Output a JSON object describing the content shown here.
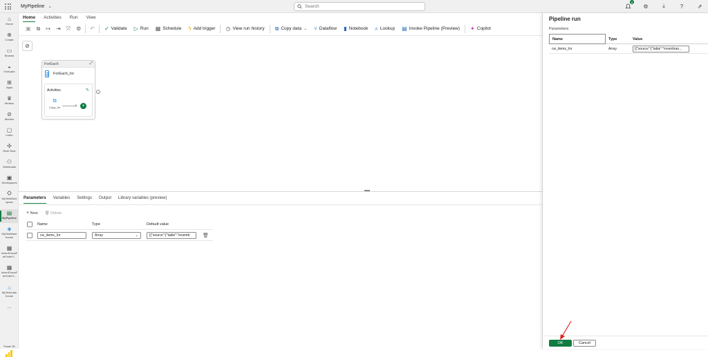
{
  "app": {
    "workspace_name": "MyPipeline",
    "search_placeholder": "Search",
    "notification_count": "8"
  },
  "colors": {
    "accent": "#107c41",
    "annotation_arrow": "#e02020",
    "powerbi_logo": "#f2c811"
  },
  "nav": {
    "items": [
      {
        "label": "Home",
        "icon": "home-icon"
      },
      {
        "label": "Create",
        "icon": "create-icon"
      },
      {
        "label": "Browse",
        "icon": "browse-icon"
      },
      {
        "label": "OneLake",
        "icon": "onelake-icon"
      },
      {
        "label": "Apps",
        "icon": "apps-icon"
      },
      {
        "label": "Metrics",
        "icon": "metrics-icon"
      },
      {
        "label": "Monitor",
        "icon": "monitor-icon"
      },
      {
        "label": "Learn",
        "icon": "learn-icon"
      },
      {
        "label": "Real-Time",
        "icon": "realtime-icon"
      },
      {
        "label": "Workloads",
        "icon": "workloads-icon"
      },
      {
        "label": "Workspaces",
        "icon": "workspaces-icon"
      },
      {
        "label": "MyTestWork space",
        "icon": "workspace-icon"
      },
      {
        "label": "MyPipeline",
        "icon": "pipeline-icon"
      },
      {
        "label": "MyTestWare house",
        "icon": "warehouse-icon"
      },
      {
        "label": "InventTransF arOrderV...",
        "icon": "table-icon"
      },
      {
        "label": "InventTransF arOrderV...",
        "icon": "table-icon"
      },
      {
        "label": "MyTestLake house",
        "icon": "lakehouse-icon"
      },
      {
        "label": "...",
        "icon": "more-icon"
      }
    ],
    "bottom_label": "Power BI"
  },
  "ribbon": {
    "tabs": [
      "Home",
      "Activities",
      "Run",
      "View"
    ],
    "active_tab": "Home",
    "buttons": {
      "validate": "Validate",
      "run": "Run",
      "schedule": "Schedule",
      "add_trigger": "Add trigger",
      "view_run_history": "View run history",
      "copy_data": "Copy data",
      "dataflow": "Dataflow",
      "notebook": "Notebook",
      "lookup": "Lookup",
      "invoke_pipeline": "Invoke Pipeline (Preview)",
      "copilot": "Copilot"
    }
  },
  "canvas": {
    "foreach_header": "ForEach",
    "foreach_name": "ForEach_Inr",
    "activities_label": "Activities",
    "copy_label": "Copy_Inr"
  },
  "bottom_panel": {
    "tabs": [
      "Parameters",
      "Variables",
      "Settings",
      "Output",
      "Library variables (preview)"
    ],
    "new_label": "New",
    "delete_label": "Delete",
    "columns": {
      "name": "Name",
      "type": "Type",
      "default": "Default value"
    },
    "row": {
      "name": "cw_items_Inr",
      "type": "Array",
      "default": "[{\"source\":{\"table\":\"inventtr"
    }
  },
  "run_panel": {
    "title": "Pipeline run",
    "subtitle": "Parameters",
    "columns": {
      "name": "Name",
      "type": "Type",
      "value": "Value"
    },
    "row": {
      "name": "cw_items_Inr",
      "type": "Array",
      "value": "[{\"source\":{\"table\":\"inventtran..."
    },
    "ok": "OK",
    "cancel": "Cancel"
  }
}
